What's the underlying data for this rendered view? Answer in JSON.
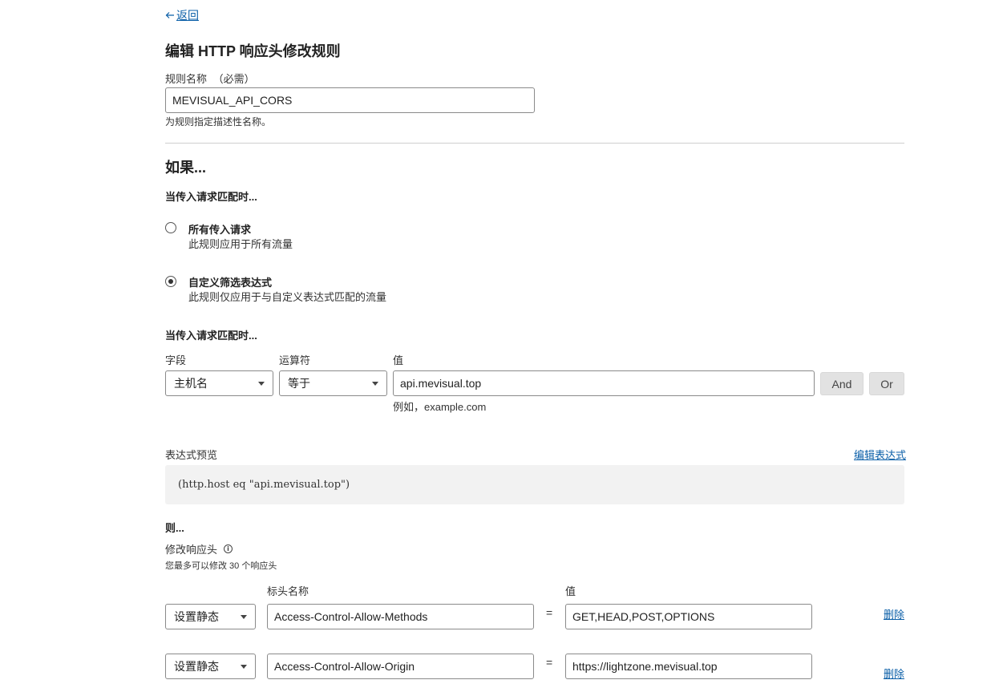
{
  "nav": {
    "back_label": "返回"
  },
  "page": {
    "title": "编辑 HTTP 响应头修改规则"
  },
  "rule_name": {
    "label": "规则名称",
    "required": "（必需）",
    "value": "MEVISUAL_API_CORS",
    "hint": "为规则指定描述性名称。"
  },
  "if_section": {
    "heading": "如果...",
    "subheading": "当传入请求匹配时...",
    "options": [
      {
        "title": "所有传入请求",
        "desc": "此规则应用于所有流量",
        "selected": false
      },
      {
        "title": "自定义筛选表达式",
        "desc": "此规则仅应用于与自定义表达式匹配的流量",
        "selected": true
      }
    ]
  },
  "match": {
    "heading": "当传入请求匹配时...",
    "field_label": "字段",
    "operator_label": "运算符",
    "value_label": "值",
    "field_value": "主机名",
    "operator_value": "等于",
    "value": "api.mevisual.top",
    "value_hint": "例如，example.com",
    "and_label": "And",
    "or_label": "Or"
  },
  "expression": {
    "label": "表达式预览",
    "edit_link": "编辑表达式",
    "text": "(http.host eq \"api.mevisual.top\")"
  },
  "then_section": {
    "heading": "则...",
    "label": "修改响应头",
    "hint": "您最多可以修改 30 个响应头",
    "header_name_label": "标头名称",
    "value_label": "值",
    "equals": "=",
    "delete_label": "删除",
    "rows": [
      {
        "action": "设置静态",
        "name": "Access-Control-Allow-Methods",
        "value": "GET,HEAD,POST,OPTIONS"
      },
      {
        "action": "设置静态",
        "name": "Access-Control-Allow-Origin",
        "value": "https://lightzone.mevisual.top"
      }
    ]
  },
  "colors": {
    "link": "#0b5fa8",
    "button_gray": "#e2e2e2",
    "preview_bg": "#f2f2f2"
  }
}
